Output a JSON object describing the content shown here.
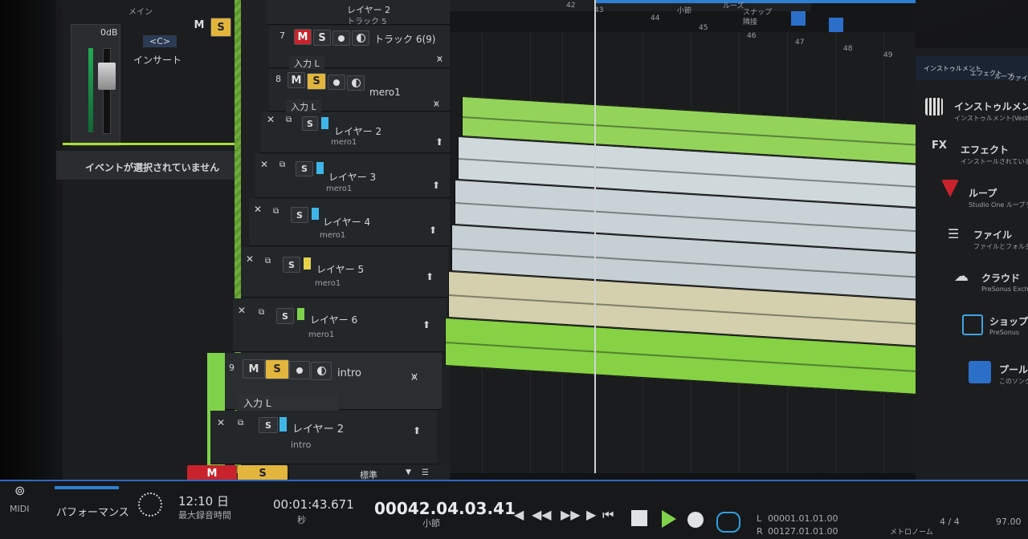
{
  "inspector": {
    "main_label": "メイン",
    "gain": "0dB",
    "pan": "<C>",
    "m_label": "M",
    "s_label": "S",
    "insert_label": "インサート",
    "no_event": "イベントが選択されていません"
  },
  "ruler": {
    "ticks": [
      "42",
      "43",
      "44",
      "45",
      "46",
      "47",
      "48",
      "49"
    ],
    "labels": [
      "小節",
      "ルーズ",
      "スナップ",
      "隣接"
    ]
  },
  "tracks": [
    {
      "id": "trk-top",
      "layer": "レイヤー 2",
      "sub": "トラック 5"
    },
    {
      "id": "trk7",
      "num": "7",
      "name": "トラック 6(9)",
      "input": "入力 L",
      "m_active": true,
      "s_active": false
    },
    {
      "id": "trk8",
      "num": "8",
      "name": "mero1",
      "input": "入力 L",
      "m_active": false,
      "s_active": true
    }
  ],
  "layers": [
    {
      "name": "レイヤー 2",
      "sub": "mero1",
      "color": "#3fb6e8"
    },
    {
      "name": "レイヤー 3",
      "sub": "mero1",
      "color": "#3fb6e8"
    },
    {
      "name": "レイヤー 4",
      "sub": "mero1",
      "color": "#3fb6e8"
    },
    {
      "name": "レイヤー 5",
      "sub": "mero1",
      "color": "#e6d34a"
    },
    {
      "name": "レイヤー 6",
      "sub": "mero1",
      "color": "#7ed34a"
    }
  ],
  "track9": {
    "num": "9",
    "name": "intro",
    "input": "入力 L",
    "layer": "レイヤー 2",
    "sub": "intro"
  },
  "bottom_strip": {
    "m": "M",
    "s": "S",
    "preset": "標準"
  },
  "browser": {
    "tabs": [
      "インストゥルメント",
      "エフェクト",
      "ループ",
      "ファイル"
    ],
    "items": [
      {
        "title": "インストゥルメント",
        "sub": "インストゥルメント(Vestax)の..."
      },
      {
        "title": "エフェクト",
        "sub": "インストールされているエ..."
      },
      {
        "title": "ループ",
        "sub": "Studio One ループライブ..."
      },
      {
        "title": "ファイル",
        "sub": "ファイルとフォルダーを..."
      },
      {
        "title": "クラウド",
        "sub": "PreSonus Exch..."
      },
      {
        "title": "ショップ",
        "sub": "PreSonus"
      },
      {
        "title": "プール",
        "sub": "このソング..."
      }
    ]
  },
  "transport": {
    "midi": "MIDI",
    "performance": "パフォーマンス",
    "record_time": "12:10 日",
    "record_label": "最大録音時間",
    "seconds": "00:01:43.671",
    "seconds_label": "秒",
    "bars": "00042.04.03.41",
    "bars_label": "小節",
    "loop_l": "00001.01.01.00",
    "loop_r": "00127.01.01.00",
    "l": "L",
    "r": "R",
    "signature": "4 / 4",
    "metronome": "メトロノーム",
    "tempo": "97.00"
  }
}
